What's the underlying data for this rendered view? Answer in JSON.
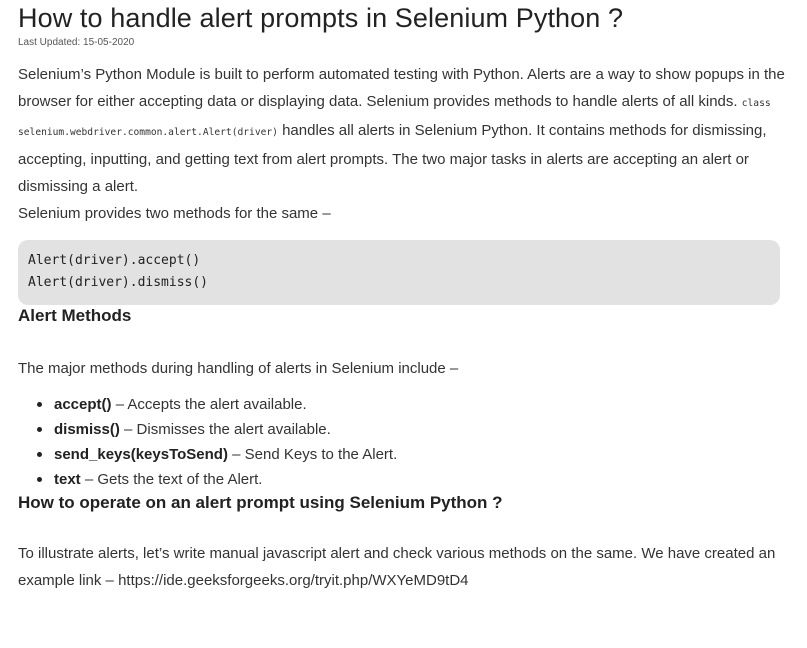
{
  "article": {
    "title": "How to handle alert prompts in Selenium Python ?",
    "last_updated": "Last Updated: 15-05-2020",
    "intro": {
      "part1": "Selenium’s Python Module is built to perform automated testing with Python. Alerts are a way to show popups in the browser for either accepting data or displaying data. Selenium provides methods to handle alerts of all kinds. ",
      "code": "class selenium.webdriver.common.alert.Alert(driver)",
      "part2": " handles all alerts in Selenium Python. It contains methods for dismissing, accepting, inputting, and getting text from alert prompts. The two major tasks in alerts are accepting an alert or dismissing a alert.",
      "part3": "Selenium provides two methods for the same –"
    },
    "code_block": [
      "Alert(driver).accept()",
      "Alert(driver).dismiss()"
    ],
    "methods_heading": "Alert Methods",
    "methods_intro": "The major methods during handling of alerts in Selenium include –",
    "methods": [
      {
        "name": "accept()",
        "desc": " – Accepts the alert available."
      },
      {
        "name": "dismiss()",
        "desc": " – Dismisses the alert available."
      },
      {
        "name": "send_keys(keysToSend)",
        "desc": " – Send Keys to the Alert."
      },
      {
        "name": "text",
        "desc": " – Gets the text of the Alert."
      }
    ],
    "operate_heading": "How to operate on an alert prompt using Selenium Python ?",
    "illustrate_text": "To illustrate alerts, let’s write manual javascript alert and check various methods on the same. We have created an example link – ",
    "example_link": "https://ide.geeksforgeeks.org/tryit.php/WXYeMD9tD4"
  }
}
